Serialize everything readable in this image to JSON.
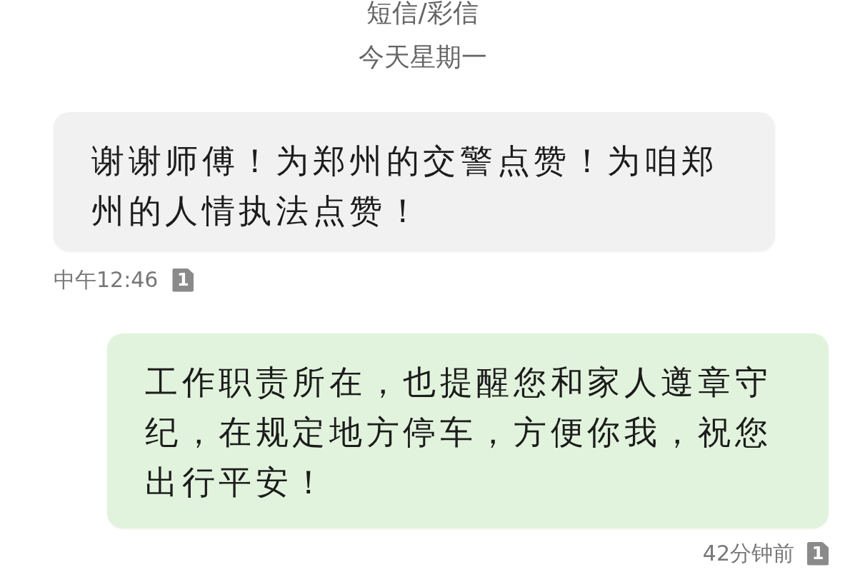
{
  "header": {
    "title": "短信/彩信",
    "date": "今天星期一"
  },
  "messages": [
    {
      "kind": "incoming",
      "text": "谢谢师傅！为郑州的交警点赞！为咱郑州的人情执法点赞！",
      "time": "中午12:46",
      "sim": "1"
    },
    {
      "kind": "outgoing",
      "text": "工作职责所在，也提醒您和家人遵章守纪，在规定地方停车，方便你我，祝您出行平安！",
      "time": "42分钟前",
      "sim": "1"
    }
  ]
}
